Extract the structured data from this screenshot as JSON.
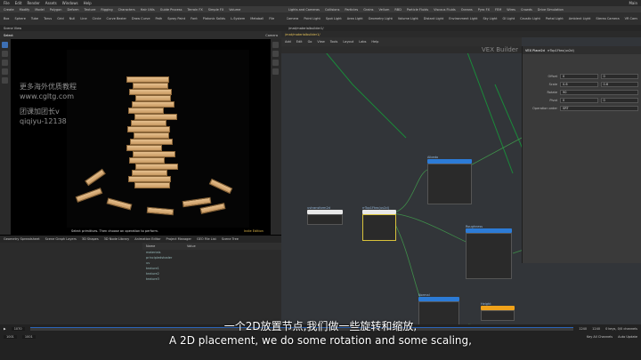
{
  "menubar": {
    "items": [
      "File",
      "Edit",
      "Render",
      "Assets",
      "Windows",
      "Help"
    ],
    "build": "Main"
  },
  "shelf_left_tabs": [
    "Create",
    "Modify",
    "Model",
    "Polygon",
    "Deform",
    "Texture",
    "Rigging",
    "Characters",
    "Hair Utils",
    "Guide Process",
    "Terrain FX",
    "Simple FX",
    "Volume"
  ],
  "shelf_right_tabs": [
    "Lights and Cameras",
    "Collisions",
    "Particles",
    "Grains",
    "Vellum",
    "RBD",
    "Particle Fluids",
    "Viscous Fluids",
    "Oceans",
    "Pyro FX",
    "FEM",
    "Wires",
    "Crowds",
    "Drive Simulation"
  ],
  "shelf_tools": [
    "Box",
    "Sphere",
    "Tube",
    "Torus",
    "Grid",
    "Null",
    "Line",
    "Circle",
    "Curve Bezier",
    "Draw Curve",
    "Path",
    "Spray Paint",
    "Font",
    "Platonic Solids",
    "L-System",
    "Metaball",
    "File"
  ],
  "light_tools": [
    "Camera",
    "Point Light",
    "Spot Light",
    "Area Light",
    "Geometry Light",
    "Volume Light",
    "Distant Light",
    "Environment Light",
    "Sky Light",
    "GI Light",
    "Caustic Light",
    "Portal Light",
    "Ambient Light",
    "Stereo Camera",
    "VR Camera",
    "Switcher",
    "Gamepad Camera"
  ],
  "viewport": {
    "tab": "Scene View",
    "camera_label": "Camera",
    "state_label": "Select",
    "hint": "Select primitives. Then choose an operation to perform.",
    "status": "Indie Edition"
  },
  "watermark": {
    "line1": "更多海外优质教程",
    "line2": "www.cgltg.com",
    "line3": "团课加团长v",
    "line4": "qiqiyu-12138"
  },
  "network": {
    "path": "/mat/materialbuilder1/",
    "menu": [
      "Add",
      "Edit",
      "Go",
      "View",
      "Tools",
      "Layout",
      "Labs",
      "Help"
    ],
    "builder_label": "VEX Builder",
    "nodes": [
      {
        "name": "Albedo",
        "sub": "texture"
      },
      {
        "name": "rrTop1Ftex(uv2d)",
        "sub": "uvtransform"
      },
      {
        "name": "Roughness",
        "sub": "texture"
      },
      {
        "name": "Normal",
        "sub": "texture"
      },
      {
        "name": "Height",
        "sub": "texture"
      },
      {
        "name": "uvtransform2d",
        "sub": "uv"
      }
    ]
  },
  "params": {
    "title": "VEX Place2d",
    "node_name": "rrTop1Ftex(uv2d)",
    "rows": [
      {
        "label": "Offset",
        "v1": "0",
        "v2": "0"
      },
      {
        "label": "Scale",
        "v1": "0.6",
        "v2": "0.6"
      },
      {
        "label": "Rotate",
        "v1": "90",
        "v2": ""
      },
      {
        "label": "Pivot",
        "v1": "0",
        "v2": "0"
      },
      {
        "label": "Operation order",
        "v1": "SRT",
        "v2": ""
      }
    ]
  },
  "bottom": {
    "tabs": [
      "Geometry Spreadsheet",
      "Scene Graph Layers",
      "3D Shapes",
      "3D Node Library",
      "Animation Editor",
      "Project Manager",
      "GEO File List",
      "Scene Tree"
    ],
    "columns": [
      "Name",
      "Value"
    ],
    "rows": [
      "materials",
      "principledshader",
      "uv",
      "texture1",
      "texture2",
      "texture3"
    ]
  },
  "timeline": {
    "frame": "1070",
    "start": "1001",
    "end": "1001",
    "range_end": "1240",
    "range_end2": "1240",
    "keys": "0 keys, 0/0 channels",
    "key_all": "Key All Channels",
    "auto_update": "Auto Update"
  },
  "subtitle": {
    "cn": "一个2D放置节点,我们做一些旋转和缩放,",
    "en": "A 2D placement, we do some rotation and some scaling,"
  }
}
